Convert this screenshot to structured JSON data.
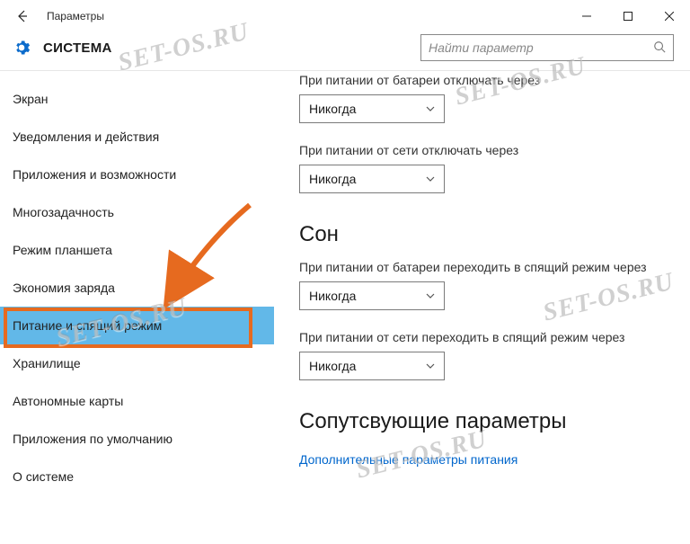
{
  "window": {
    "title": "Параметры"
  },
  "header": {
    "page_title": "СИСТЕМА",
    "search_placeholder": "Найти параметр"
  },
  "sidebar": {
    "items": [
      {
        "label": "Экран"
      },
      {
        "label": "Уведомления и действия"
      },
      {
        "label": "Приложения и возможности"
      },
      {
        "label": "Многозадачность"
      },
      {
        "label": "Режим планшета"
      },
      {
        "label": "Экономия заряда"
      },
      {
        "label": "Питание и спящий режим",
        "active": true
      },
      {
        "label": "Хранилище"
      },
      {
        "label": "Автономные карты"
      },
      {
        "label": "Приложения по умолчанию"
      },
      {
        "label": "О системе"
      }
    ]
  },
  "content": {
    "cut_label": "При питании от батареи отключать через",
    "battery_off_value": "Никогда",
    "ac_off_label": "При питании от сети отключать через",
    "ac_off_value": "Никогда",
    "sleep_section": "Сон",
    "battery_sleep_label": "При питании от батареи переходить в спящий режим через",
    "battery_sleep_value": "Никогда",
    "ac_sleep_label": "При питании от сети переходить в спящий режим через",
    "ac_sleep_value": "Никогда",
    "related_section": "Сопутсвующие параметры",
    "related_link": "Дополнительные параметры питания"
  },
  "watermark_text": "SET-OS.RU"
}
